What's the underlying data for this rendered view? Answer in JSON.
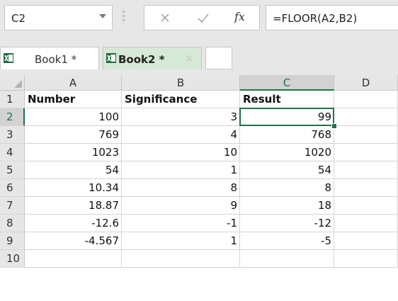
{
  "formula_bar": {
    "name_box": "C2",
    "formula": "=FLOOR(A2,B2)",
    "fx_label": "fx"
  },
  "workbooks": [
    {
      "label": "Book1 *"
    },
    {
      "label": "Book2 *"
    }
  ],
  "columns": [
    "A",
    "B",
    "C",
    "D"
  ],
  "selected_cell": "C2",
  "rows": [
    {
      "num": "1",
      "cells": [
        "Number",
        "Significance",
        "Result",
        ""
      ]
    },
    {
      "num": "2",
      "cells": [
        "100",
        "3",
        "99",
        ""
      ]
    },
    {
      "num": "3",
      "cells": [
        "769",
        "4",
        "768",
        ""
      ]
    },
    {
      "num": "4",
      "cells": [
        "1023",
        "10",
        "1020",
        ""
      ]
    },
    {
      "num": "5",
      "cells": [
        "54",
        "1",
        "54",
        ""
      ]
    },
    {
      "num": "6",
      "cells": [
        "10.34",
        "8",
        "8",
        ""
      ]
    },
    {
      "num": "7",
      "cells": [
        "18.87",
        "9",
        "18",
        ""
      ]
    },
    {
      "num": "8",
      "cells": [
        "-12.6",
        "-1",
        "-12",
        ""
      ]
    },
    {
      "num": "9",
      "cells": [
        "-4.567",
        "1",
        "-5",
        ""
      ]
    },
    {
      "num": "10",
      "cells": [
        "",
        "",
        "",
        ""
      ]
    }
  ],
  "colors": {
    "accent": "#217346",
    "chrome": "#e7e7e7",
    "header_bg": "#e6e6e6"
  }
}
